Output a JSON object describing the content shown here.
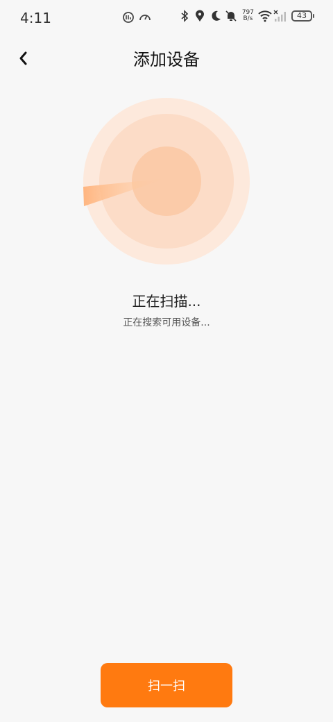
{
  "status_bar": {
    "time": "4:11",
    "net_speed_value": "797",
    "net_speed_unit": "B/s",
    "battery": "43",
    "icons": [
      "data-saver-icon",
      "speed-icon",
      "bluetooth-icon",
      "location-icon",
      "moon-icon",
      "bell-off-icon",
      "wifi-icon",
      "signal-icon",
      "battery-icon"
    ]
  },
  "header": {
    "title": "添加设备",
    "back_icon": "chevron-left-icon"
  },
  "scan": {
    "title": "正在扫描...",
    "subtitle": "正在搜索可用设备..."
  },
  "actions": {
    "scan_button_label": "扫一扫"
  },
  "colors": {
    "accent": "#ff7a10",
    "background": "#f7f7f7",
    "radar_outer": "#fde6d8",
    "radar_middle": "#fcd9c3",
    "radar_inner": "#fbcaa8"
  }
}
